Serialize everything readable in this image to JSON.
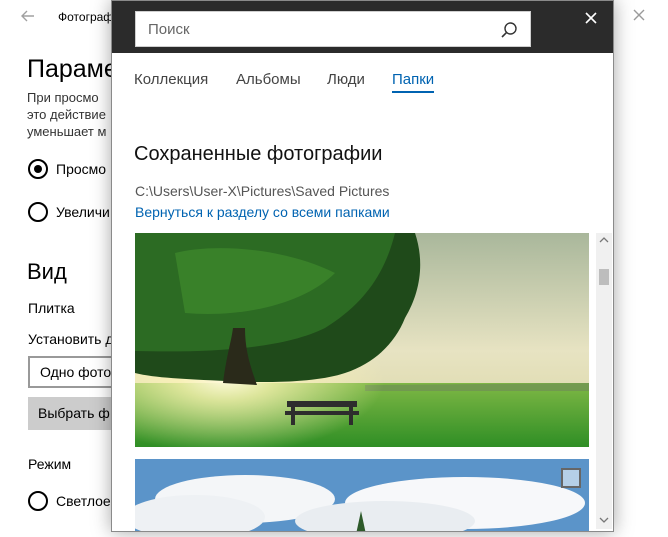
{
  "background_window": {
    "title": "Фотограф",
    "heading": "Парамет",
    "truncated_text": [
      "При просмо",
      "это действие",
      "уменьшает м"
    ],
    "radio_options": [
      {
        "label": "Просмо",
        "checked": true
      },
      {
        "label": "Увеличи",
        "checked": false
      }
    ],
    "view_section": {
      "heading": "Вид",
      "tile_label": "Плитка",
      "set_label": "Установить д",
      "select_value": "Одно фото",
      "choose_button": "Выбрать ф"
    },
    "mode_section": {
      "label": "Режим",
      "option": "Светлое"
    }
  },
  "flyout": {
    "search": {
      "placeholder": "Поиск",
      "value": ""
    },
    "tabs": [
      {
        "label": "Коллекция",
        "active": false
      },
      {
        "label": "Альбомы",
        "active": false
      },
      {
        "label": "Люди",
        "active": false
      },
      {
        "label": "Папки",
        "active": true
      }
    ],
    "folder": {
      "title": "Сохраненные фотографии",
      "path": "C:\\Users\\User-X\\Pictures\\Saved Pictures",
      "back_link": "Вернуться к разделу со всеми папками"
    },
    "photos": [
      {
        "description_icon": "tree-meadow-photo"
      },
      {
        "description_icon": "sky-clouds-photo"
      }
    ]
  },
  "colors": {
    "accent": "#0063b1",
    "header_bg": "#2b2b2b"
  }
}
